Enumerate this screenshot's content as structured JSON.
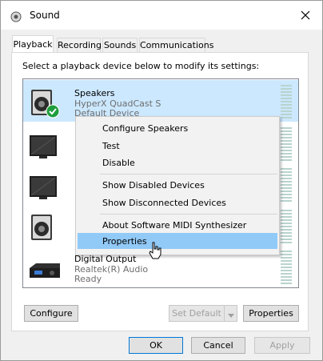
{
  "window": {
    "title": "Sound",
    "icon": "speaker-icon",
    "close_icon": "close-icon"
  },
  "tabs": [
    {
      "label": "Playback",
      "active": true
    },
    {
      "label": "Recording",
      "active": false
    },
    {
      "label": "Sounds",
      "active": false
    },
    {
      "label": "Communications",
      "active": false
    }
  ],
  "instruction": "Select a playback device below to modify its settings:",
  "devices": [
    {
      "name": "Speakers",
      "line1": "HyperX QuadCast S",
      "line2": "Default Device",
      "icon": "speaker-icon",
      "default_check": "check-icon",
      "selected": true
    },
    {
      "icon": "monitor-icon"
    },
    {
      "icon": "monitor-icon"
    },
    {
      "icon": "speaker-icon"
    },
    {
      "name": "Digital Output",
      "line1": "Realtek(R) Audio",
      "line2": "Ready",
      "icon": "receiver-icon"
    }
  ],
  "context_menu": {
    "items": [
      "Configure Speakers",
      "Test",
      "Disable",
      "Show Disabled Devices",
      "Show Disconnected Devices",
      "About Software MIDI Synthesizer",
      "Properties"
    ],
    "highlighted": "Properties"
  },
  "buttons": {
    "configure": "Configure",
    "set_default": "Set Default",
    "properties": "Properties",
    "ok": "OK",
    "cancel": "Cancel",
    "apply": "Apply"
  },
  "colors": {
    "selection": "#cce8ff",
    "menu_highlight": "#91c9f7",
    "meter": "#b9d3cf",
    "check": "#1e9e3e",
    "default_border": "#0078d7"
  }
}
